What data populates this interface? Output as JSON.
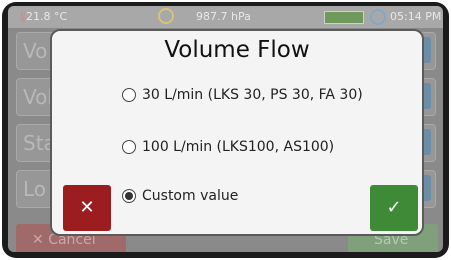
{
  "statusbar": {
    "temperature": "21.8 °C",
    "pressure": "987.7 hPa",
    "time": "05:14 PM"
  },
  "background": {
    "rows": [
      {
        "label": "Vo"
      },
      {
        "label": "Vol"
      },
      {
        "label": "Sta"
      },
      {
        "label": "Lo"
      }
    ],
    "cancel_label": "Cancel",
    "save_label": "Save"
  },
  "dialog": {
    "title": "Volume Flow",
    "options": [
      {
        "label": "30 L/min (LKS 30, PS 30, FA 30)",
        "selected": false
      },
      {
        "label": "100 L/min (LKS100, AS100)",
        "selected": false
      },
      {
        "label": "Custom value",
        "selected": true
      }
    ],
    "cancel_icon": "✕",
    "confirm_icon": "✓"
  },
  "colors": {
    "cancel": "#9b1d20",
    "confirm": "#3f8a36",
    "edit": "#6b8ea6"
  },
  "icons": {
    "temperature": "thermometer-icon",
    "pressure": "gauge-icon",
    "battery": "battery-icon",
    "clock": "clock-icon",
    "edit": "pencil-icon"
  }
}
